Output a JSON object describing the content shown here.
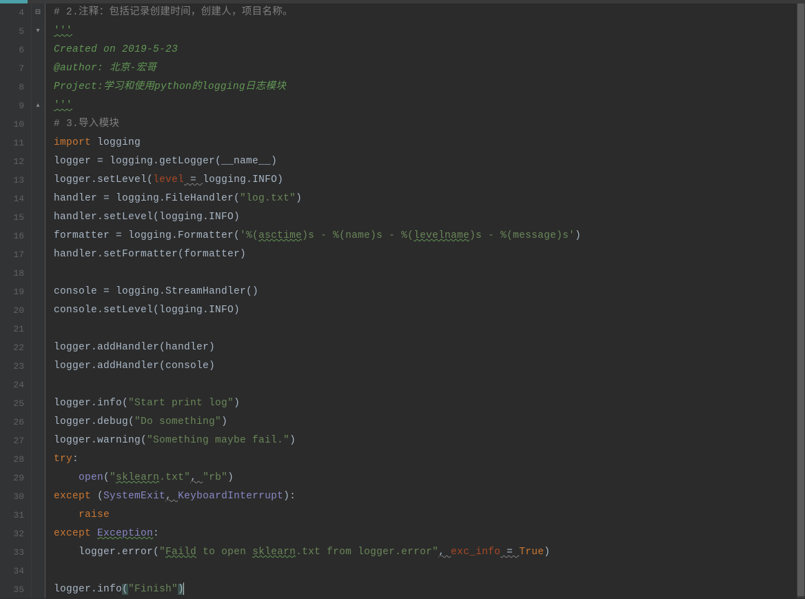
{
  "gutter": {
    "start": 4,
    "end": 35
  },
  "fold_markers": [
    {
      "line": 4,
      "type": "box"
    },
    {
      "line": 5,
      "type": "down"
    },
    {
      "line": 9,
      "type": "up"
    }
  ],
  "code": {
    "lines": [
      {
        "n": 4,
        "segs": [
          {
            "t": "# 2.注释：包括记录创建时间，创建人，项目名称。",
            "c": "c-comment"
          }
        ]
      },
      {
        "n": 5,
        "segs": [
          {
            "t": "'''",
            "c": "c-triple squiggle-green"
          }
        ]
      },
      {
        "n": 6,
        "segs": [
          {
            "t": "Created on 2019-5-23",
            "c": "c-docstring"
          }
        ]
      },
      {
        "n": 7,
        "segs": [
          {
            "t": "@author: 北京-宏哥",
            "c": "c-docstring"
          }
        ]
      },
      {
        "n": 8,
        "segs": [
          {
            "t": "Project:学习和使用python的logging日志模块",
            "c": "c-docstring"
          }
        ]
      },
      {
        "n": 9,
        "segs": [
          {
            "t": "'''",
            "c": "c-triple squiggle-green"
          }
        ]
      },
      {
        "n": 10,
        "segs": [
          {
            "t": "# 3.导入模块",
            "c": "c-comment"
          }
        ]
      },
      {
        "n": 11,
        "segs": [
          {
            "t": "import",
            "c": "c-keyword"
          },
          {
            "t": " logging",
            "c": "c-identifier"
          }
        ]
      },
      {
        "n": 12,
        "segs": [
          {
            "t": "logger = logging.getLogger(",
            "c": "c-identifier"
          },
          {
            "t": "__name__",
            "c": "c-identifier"
          },
          {
            "t": ")",
            "c": "c-identifier"
          }
        ]
      },
      {
        "n": 13,
        "segs": [
          {
            "t": "logger.setLevel(",
            "c": "c-identifier"
          },
          {
            "t": "level",
            "c": "c-param"
          },
          {
            "t": " = ",
            "c": "c-op squiggle"
          },
          {
            "t": "logging.INFO)",
            "c": "c-identifier"
          }
        ]
      },
      {
        "n": 14,
        "segs": [
          {
            "t": "handler = logging.FileHandler(",
            "c": "c-identifier"
          },
          {
            "t": "\"log.txt\"",
            "c": "c-string"
          },
          {
            "t": ")",
            "c": "c-identifier"
          }
        ]
      },
      {
        "n": 15,
        "segs": [
          {
            "t": "handler.setLevel(logging.INFO)",
            "c": "c-identifier"
          }
        ]
      },
      {
        "n": 16,
        "segs": [
          {
            "t": "formatter = logging.Formatter(",
            "c": "c-identifier"
          },
          {
            "t": "'%(",
            "c": "c-string"
          },
          {
            "t": "asctime",
            "c": "c-string squiggle-green"
          },
          {
            "t": ")s - %(name)s - %(",
            "c": "c-string"
          },
          {
            "t": "levelname",
            "c": "c-string squiggle-green"
          },
          {
            "t": ")s - %(message)s'",
            "c": "c-string"
          },
          {
            "t": ")",
            "c": "c-identifier"
          }
        ]
      },
      {
        "n": 17,
        "segs": [
          {
            "t": "handler.setFormatter(formatter)",
            "c": "c-identifier"
          }
        ]
      },
      {
        "n": 18,
        "segs": []
      },
      {
        "n": 19,
        "segs": [
          {
            "t": "console = logging.StreamHandler()",
            "c": "c-identifier"
          }
        ]
      },
      {
        "n": 20,
        "segs": [
          {
            "t": "console.setLevel(logging.INFO)",
            "c": "c-identifier"
          }
        ]
      },
      {
        "n": 21,
        "segs": []
      },
      {
        "n": 22,
        "segs": [
          {
            "t": "logger.addHandler(handler)",
            "c": "c-identifier"
          }
        ]
      },
      {
        "n": 23,
        "segs": [
          {
            "t": "logger.addHandler(console)",
            "c": "c-identifier"
          }
        ]
      },
      {
        "n": 24,
        "segs": []
      },
      {
        "n": 25,
        "segs": [
          {
            "t": "logger.info(",
            "c": "c-identifier"
          },
          {
            "t": "\"Start print log\"",
            "c": "c-string"
          },
          {
            "t": ")",
            "c": "c-identifier"
          }
        ]
      },
      {
        "n": 26,
        "segs": [
          {
            "t": "logger.debug(",
            "c": "c-identifier"
          },
          {
            "t": "\"Do something\"",
            "c": "c-string"
          },
          {
            "t": ")",
            "c": "c-identifier"
          }
        ]
      },
      {
        "n": 27,
        "segs": [
          {
            "t": "logger.warning(",
            "c": "c-identifier"
          },
          {
            "t": "\"Something maybe fail.\"",
            "c": "c-string"
          },
          {
            "t": ")",
            "c": "c-identifier"
          }
        ]
      },
      {
        "n": 28,
        "segs": [
          {
            "t": "try",
            "c": "c-keyword"
          },
          {
            "t": ":",
            "c": "c-identifier"
          }
        ]
      },
      {
        "n": 29,
        "segs": [
          {
            "t": "    ",
            "c": ""
          },
          {
            "t": "open",
            "c": "c-builtin"
          },
          {
            "t": "(",
            "c": "c-identifier"
          },
          {
            "t": "\"",
            "c": "c-string"
          },
          {
            "t": "sklearn",
            "c": "c-string squiggle-green"
          },
          {
            "t": ".txt\"",
            "c": "c-string"
          },
          {
            "t": ", ",
            "c": "c-identifier squiggle"
          },
          {
            "t": "\"rb\"",
            "c": "c-string"
          },
          {
            "t": ")",
            "c": "c-identifier"
          }
        ]
      },
      {
        "n": 30,
        "segs": [
          {
            "t": "except",
            "c": "c-keyword"
          },
          {
            "t": " (",
            "c": "c-identifier"
          },
          {
            "t": "SystemExit",
            "c": "c-exc"
          },
          {
            "t": ", ",
            "c": "c-identifier squiggle"
          },
          {
            "t": "KeyboardInterrupt",
            "c": "c-exc"
          },
          {
            "t": "):",
            "c": "c-identifier"
          }
        ]
      },
      {
        "n": 31,
        "segs": [
          {
            "t": "    ",
            "c": ""
          },
          {
            "t": "raise",
            "c": "c-keyword"
          }
        ]
      },
      {
        "n": 32,
        "segs": [
          {
            "t": "except",
            "c": "c-keyword"
          },
          {
            "t": " ",
            "c": ""
          },
          {
            "t": "Exception",
            "c": "c-exc squiggle-green"
          },
          {
            "t": ":",
            "c": "c-identifier"
          }
        ]
      },
      {
        "n": 33,
        "segs": [
          {
            "t": "    logger.error(",
            "c": "c-identifier"
          },
          {
            "t": "\"",
            "c": "c-string"
          },
          {
            "t": "Faild",
            "c": "c-string squiggle-green"
          },
          {
            "t": " to open ",
            "c": "c-string"
          },
          {
            "t": "sklearn",
            "c": "c-string squiggle-green"
          },
          {
            "t": ".txt from logger.error\"",
            "c": "c-string"
          },
          {
            "t": ", ",
            "c": "c-identifier squiggle"
          },
          {
            "t": "exc_info",
            "c": "c-param"
          },
          {
            "t": " = ",
            "c": "c-op squiggle"
          },
          {
            "t": "True",
            "c": "c-bool"
          },
          {
            "t": ")",
            "c": "c-identifier"
          }
        ]
      },
      {
        "n": 34,
        "segs": []
      },
      {
        "n": 35,
        "segs": [
          {
            "t": "logger.info",
            "c": "c-identifier"
          },
          {
            "t": "(",
            "c": "c-identifier c-hl-paren"
          },
          {
            "t": "\"Finish\"",
            "c": "c-string"
          },
          {
            "t": ")",
            "c": "c-identifier c-hl-paren"
          }
        ],
        "caret": true
      }
    ]
  },
  "scrollbar": {
    "thumb_top": 0,
    "thumb_height": 860
  }
}
